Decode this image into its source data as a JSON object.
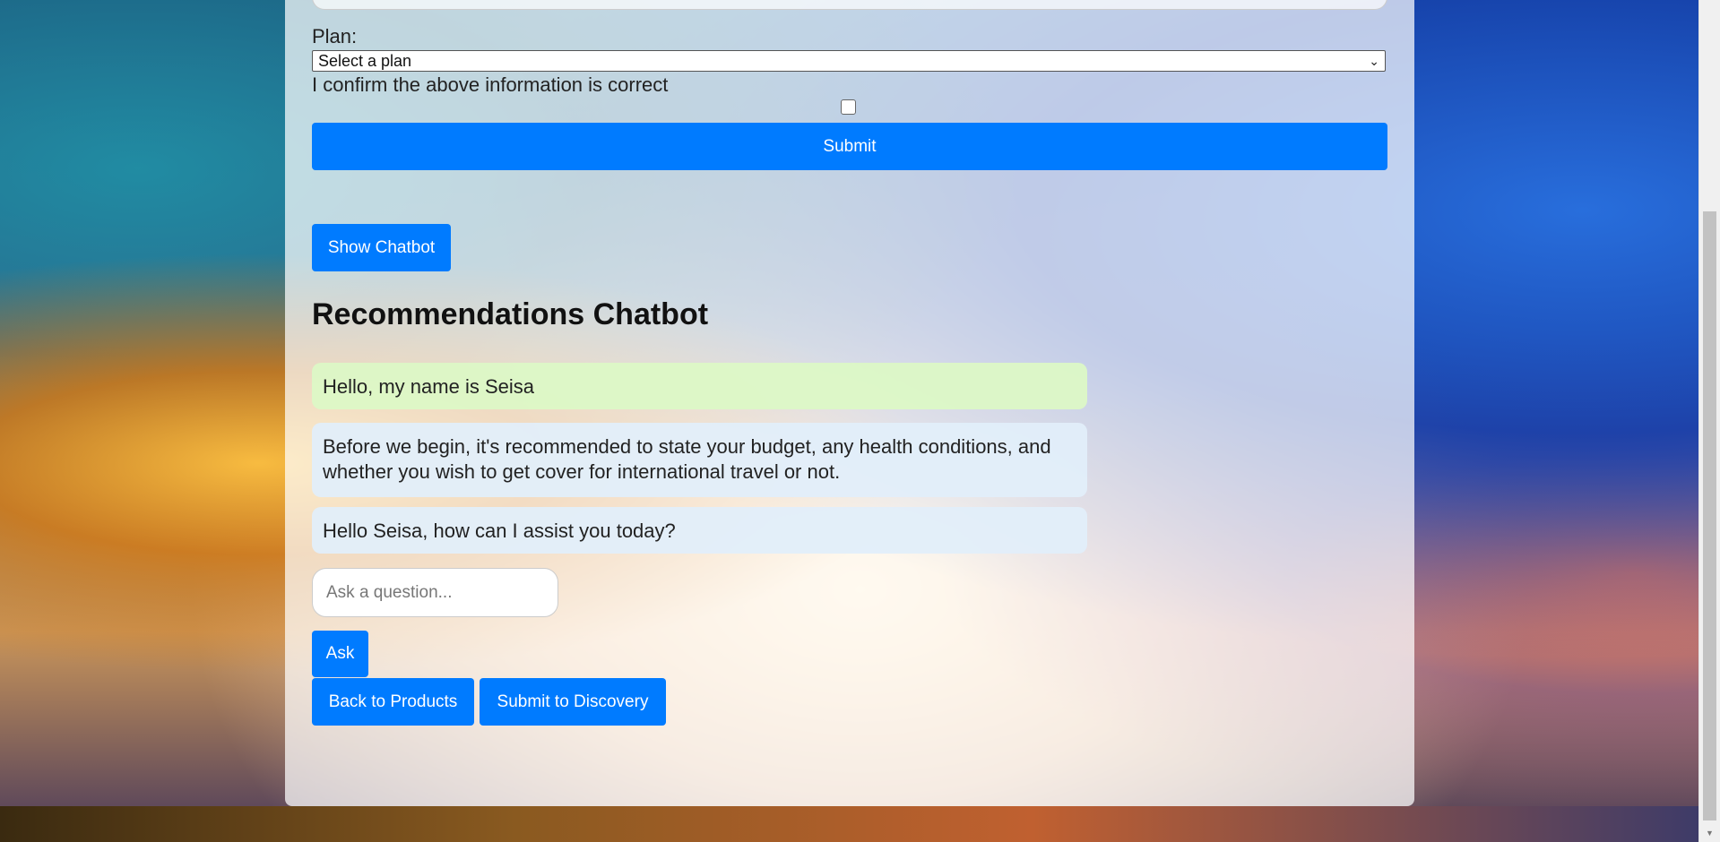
{
  "form": {
    "plan_label": "Plan:",
    "plan_select_value": "Select a plan",
    "confirm_label": "I confirm the above information is correct",
    "submit_label": "Submit"
  },
  "chatbot": {
    "show_button_label": "Show Chatbot",
    "title": "Recommendations Chatbot",
    "messages": [
      {
        "sender": "user",
        "text": "Hello, my name is Seisa"
      },
      {
        "sender": "bot",
        "text": "Before we begin, it's recommended to state your budget, any health conditions, and whether you wish to get cover for international travel or not."
      },
      {
        "sender": "bot",
        "text": "Hello Seisa, how can I assist you today?"
      }
    ],
    "input_placeholder": "Ask a question...",
    "ask_button_label": "Ask"
  },
  "footer_buttons": {
    "back_label": "Back to Products",
    "discovery_label": "Submit to Discovery"
  },
  "colors": {
    "primary": "#007bff",
    "user_bubble": "#dcf8c6",
    "bot_bubble": "#e1eefa"
  },
  "icons": {
    "select_chevron": "chevron-down-icon"
  }
}
